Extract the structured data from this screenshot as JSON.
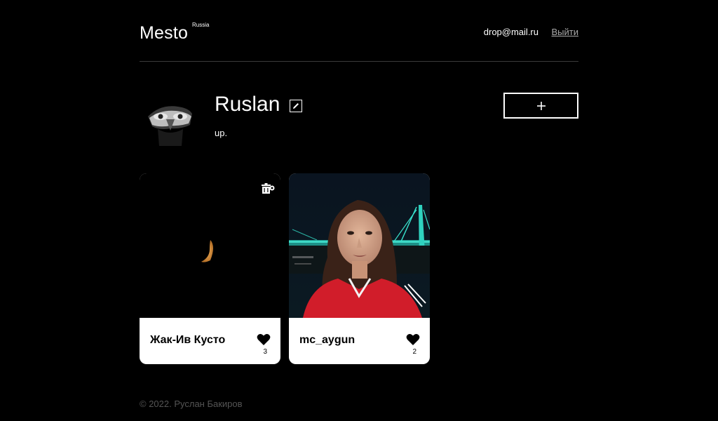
{
  "header": {
    "logo": "Mesto",
    "logo_sub": "Russia",
    "email": "drop@mail.ru",
    "logout_label": "Выйти"
  },
  "profile": {
    "name": "Ruslan",
    "about": "up.",
    "add_label": "+"
  },
  "cards": [
    {
      "title": "Жак-Ив Кусто",
      "likes": "3",
      "image_description": "night sky with crescent moon"
    },
    {
      "title": "mc_aygun",
      "likes": "2",
      "image_description": "portrait of a woman in red top at night with lit bridge"
    }
  ],
  "footer": {
    "copyright": "© 2022. Руслан Бакиров"
  },
  "icons": {
    "edit": "pencil-icon",
    "trash": "trash-icon",
    "like": "heart-icon",
    "add": "plus-icon"
  }
}
